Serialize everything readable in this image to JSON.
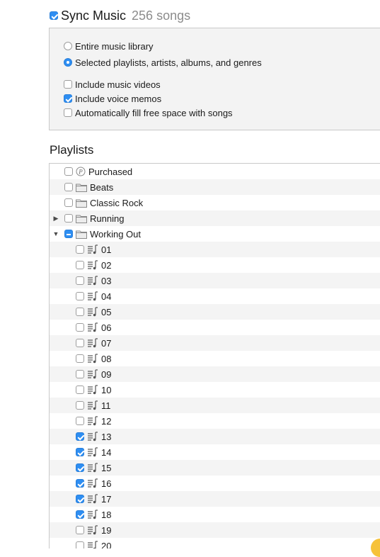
{
  "header": {
    "title": "Sync Music",
    "count": "256 songs",
    "checked": true
  },
  "options": {
    "radios": [
      {
        "label": "Entire music library",
        "selected": false
      },
      {
        "label": "Selected playlists, artists, albums, and genres",
        "selected": true
      }
    ],
    "checkboxes": [
      {
        "label": "Include music videos",
        "checked": false
      },
      {
        "label": "Include voice memos",
        "checked": true
      },
      {
        "label": "Automatically fill free space with songs",
        "checked": false
      }
    ]
  },
  "playlists_heading": "Playlists",
  "playlists": [
    {
      "name": "Purchased",
      "icon": "purchased-icon",
      "state": "unchecked",
      "level": 0,
      "expander": ""
    },
    {
      "name": "Beats",
      "icon": "folder-icon",
      "state": "unchecked",
      "level": 0,
      "expander": ""
    },
    {
      "name": "Classic Rock",
      "icon": "folder-icon",
      "state": "unchecked",
      "level": 0,
      "expander": ""
    },
    {
      "name": "Running",
      "icon": "folder-icon",
      "state": "unchecked",
      "level": 0,
      "expander": "collapsed"
    },
    {
      "name": "Working Out",
      "icon": "folder-icon",
      "state": "mixed",
      "level": 0,
      "expander": "expanded"
    },
    {
      "name": "01",
      "icon": "playlist-icon",
      "state": "unchecked",
      "level": 1,
      "expander": ""
    },
    {
      "name": "02",
      "icon": "playlist-icon",
      "state": "unchecked",
      "level": 1,
      "expander": ""
    },
    {
      "name": "03",
      "icon": "playlist-icon",
      "state": "unchecked",
      "level": 1,
      "expander": ""
    },
    {
      "name": "04",
      "icon": "playlist-icon",
      "state": "unchecked",
      "level": 1,
      "expander": ""
    },
    {
      "name": "05",
      "icon": "playlist-icon",
      "state": "unchecked",
      "level": 1,
      "expander": ""
    },
    {
      "name": "06",
      "icon": "playlist-icon",
      "state": "unchecked",
      "level": 1,
      "expander": ""
    },
    {
      "name": "07",
      "icon": "playlist-icon",
      "state": "unchecked",
      "level": 1,
      "expander": ""
    },
    {
      "name": "08",
      "icon": "playlist-icon",
      "state": "unchecked",
      "level": 1,
      "expander": ""
    },
    {
      "name": "09",
      "icon": "playlist-icon",
      "state": "unchecked",
      "level": 1,
      "expander": ""
    },
    {
      "name": "10",
      "icon": "playlist-icon",
      "state": "unchecked",
      "level": 1,
      "expander": ""
    },
    {
      "name": "11",
      "icon": "playlist-icon",
      "state": "unchecked",
      "level": 1,
      "expander": ""
    },
    {
      "name": "12",
      "icon": "playlist-icon",
      "state": "unchecked",
      "level": 1,
      "expander": ""
    },
    {
      "name": "13",
      "icon": "playlist-icon",
      "state": "checked",
      "level": 1,
      "expander": ""
    },
    {
      "name": "14",
      "icon": "playlist-icon",
      "state": "checked",
      "level": 1,
      "expander": ""
    },
    {
      "name": "15",
      "icon": "playlist-icon",
      "state": "checked",
      "level": 1,
      "expander": ""
    },
    {
      "name": "16",
      "icon": "playlist-icon",
      "state": "checked",
      "level": 1,
      "expander": ""
    },
    {
      "name": "17",
      "icon": "playlist-icon",
      "state": "checked",
      "level": 1,
      "expander": ""
    },
    {
      "name": "18",
      "icon": "playlist-icon",
      "state": "checked",
      "level": 1,
      "expander": ""
    },
    {
      "name": "19",
      "icon": "playlist-icon",
      "state": "unchecked",
      "level": 1,
      "expander": ""
    },
    {
      "name": "20",
      "icon": "playlist-icon",
      "state": "unchecked",
      "level": 1,
      "expander": ""
    }
  ],
  "colors": {
    "accent": "#2e8ef2",
    "panel_bg": "#f3f3f3",
    "row_alt": "#f4f4f4",
    "count_text": "#8c8c8c"
  }
}
